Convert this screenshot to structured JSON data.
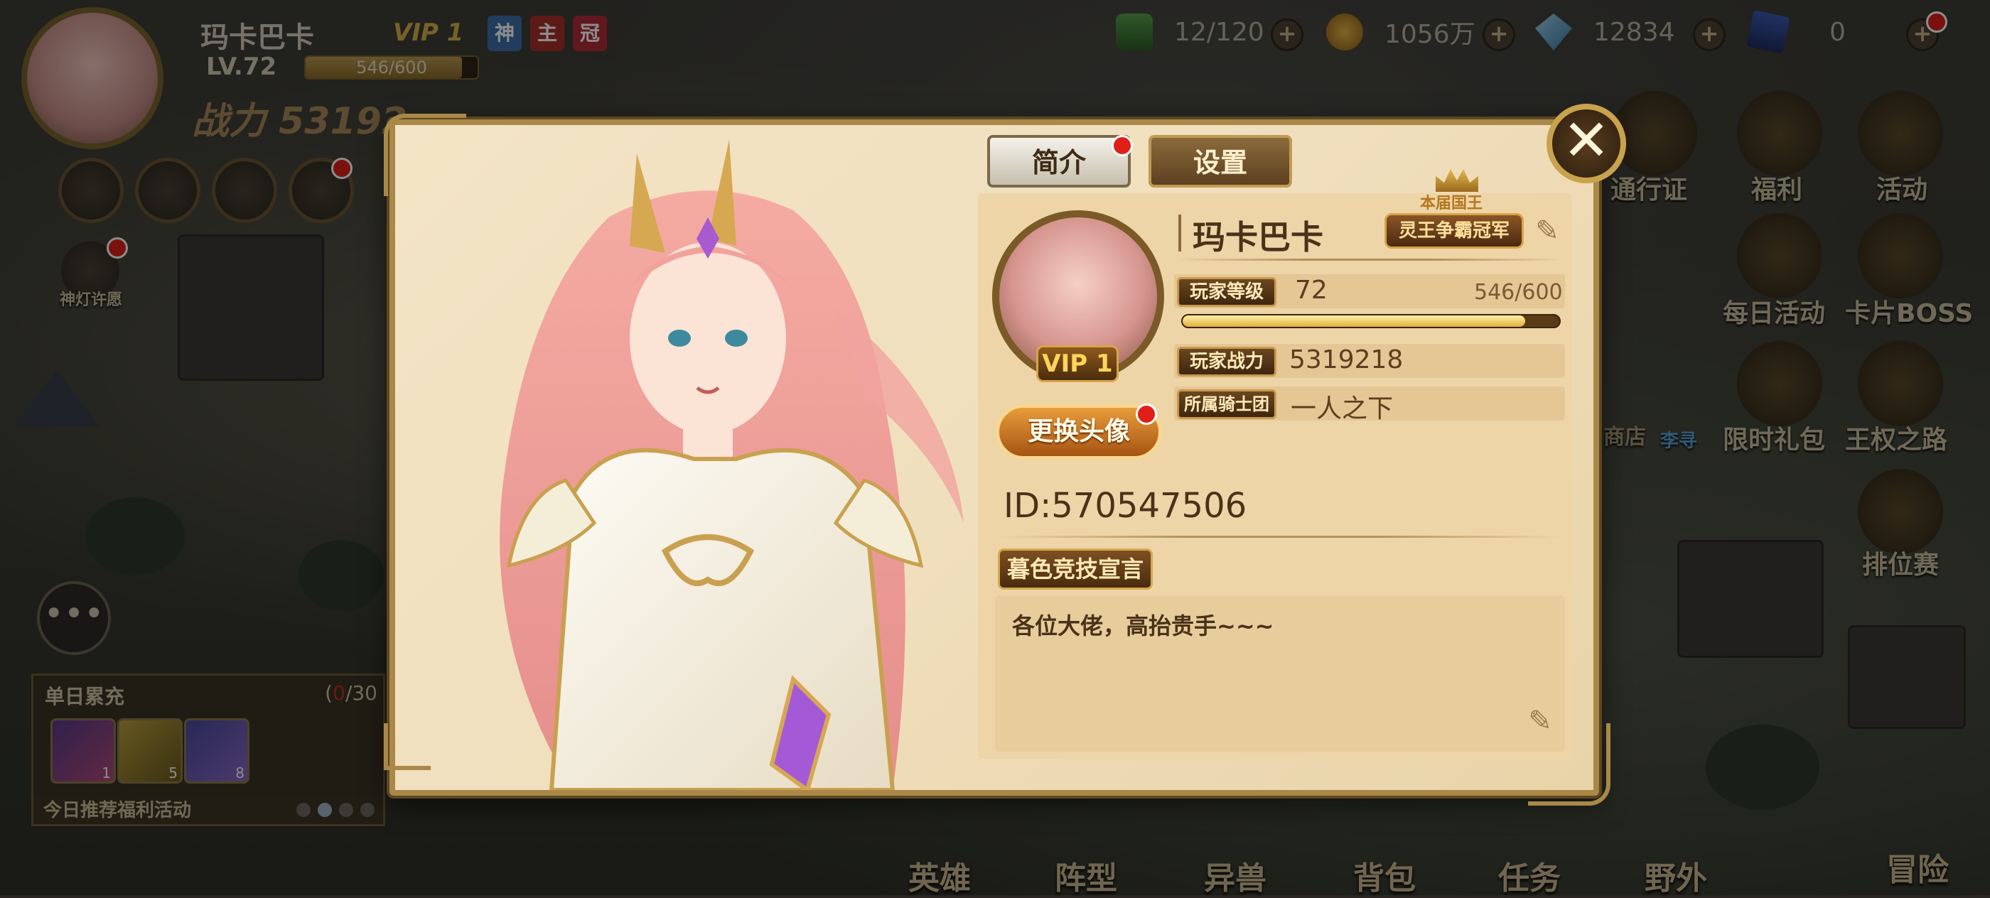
{
  "top_bar": {
    "player_name": "玛卡巴卡",
    "vip": "VIP 1",
    "badges": [
      "神",
      "主",
      "冠"
    ],
    "level": "LV.72",
    "exp_text": "546/600",
    "exp_fraction": 0.91,
    "power_prefix": "战力",
    "power_value": "53192",
    "resources": [
      {
        "icon": "stamina-potion-icon",
        "value": "12/120"
      },
      {
        "icon": "gold-coin-icon",
        "value": "1056万"
      },
      {
        "icon": "diamond-icon",
        "value": "12834"
      },
      {
        "icon": "card-ticket-icon",
        "value": "0"
      }
    ]
  },
  "right_menu": {
    "items": [
      "通行证",
      "福利",
      "活动",
      "每日活动",
      "卡片BOSS",
      "限时礼包",
      "王权之路",
      "排位赛"
    ],
    "partial_texts": [
      "商店",
      "李寻"
    ]
  },
  "left_panel": {
    "event_label": "神灯许愿",
    "recharge_title": "单日累充",
    "recharge_count_prefix": "(",
    "recharge_count_value": "0",
    "recharge_count_suffix": "/30",
    "item_counts": [
      "1",
      "5",
      "8"
    ],
    "footer": "今日推荐福利活动"
  },
  "bottom_nav": [
    "英雄",
    "阵型",
    "异兽",
    "背包",
    "任务",
    "野外",
    "冒险"
  ],
  "popup": {
    "tabs": [
      "简介",
      "设置"
    ],
    "close_icon": "close-icon",
    "portrait_vip": "VIP 1",
    "name": "玛卡巴卡",
    "title_top": "本届国王",
    "title_badge": "灵王争霸冠军",
    "rows": [
      {
        "label": "玩家等级",
        "value": "72",
        "extra": "546/600"
      },
      {
        "label": "玩家战力",
        "value": "5319218"
      },
      {
        "label": "所属骑士团",
        "value": "一人之下"
      }
    ],
    "level_progress": 0.91,
    "change_avatar": "更换头像",
    "id_text": "ID:570547506",
    "declaration_label": "暮色竞技宣言",
    "declaration_text": "各位大佬，高抬贵手~~~"
  },
  "colors": {
    "accent_gold": "#a98848",
    "parchment": "#f0dfbd",
    "dark_brown": "#4a321a",
    "red_dot": "#e02018"
  }
}
